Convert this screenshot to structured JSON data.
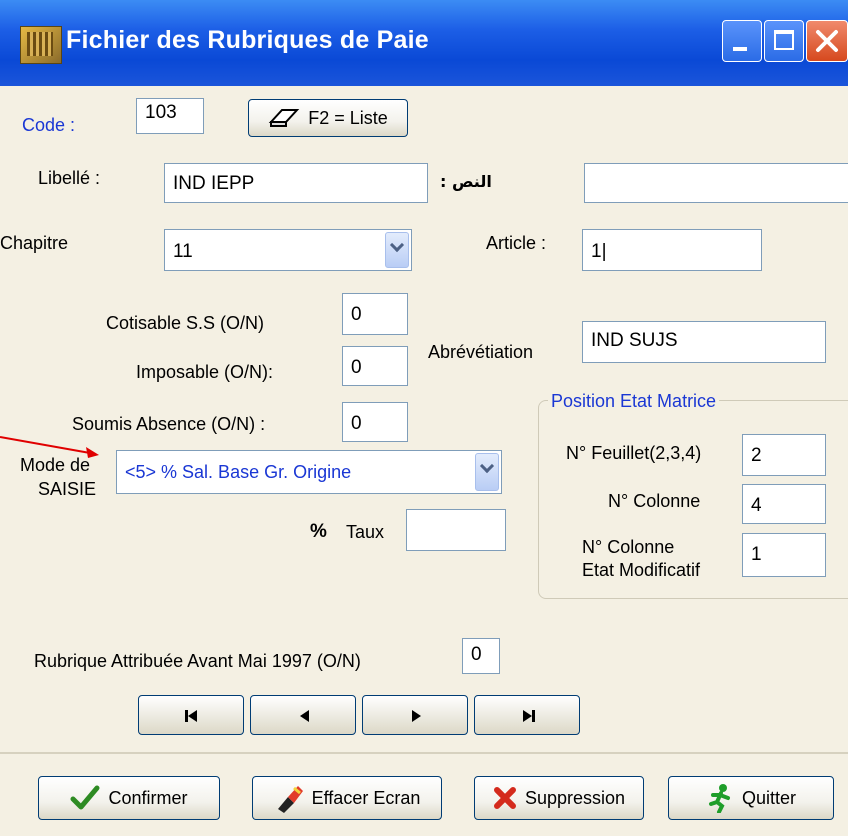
{
  "window": {
    "title": "Fichier des Rubriques de Paie"
  },
  "code": {
    "label": "Code :",
    "value": "103"
  },
  "liste_button": {
    "label": "F2 = Liste"
  },
  "libelle": {
    "label": "Libellé :",
    "value": "IND IEPP"
  },
  "arabic": {
    "label": ": النص",
    "value": ""
  },
  "chapitre": {
    "label": "Chapitre",
    "value": "11"
  },
  "article": {
    "label": "Article :",
    "value": "1|"
  },
  "cotisable": {
    "label": "Cotisable S.S (O/N)",
    "value": "0"
  },
  "imposable": {
    "label": "Imposable (O/N):",
    "value": "0"
  },
  "abreviation": {
    "label": "Abrévétiation",
    "value": "IND SUJS"
  },
  "soumis": {
    "label": "Soumis Absence (O/N) :",
    "value": "0"
  },
  "mode_saisie": {
    "label_line1": "Mode de",
    "label_line2": "SAISIE",
    "value": "<5>  % Sal. Base Gr. Origine"
  },
  "taux": {
    "symbol": "%",
    "label": "Taux",
    "value": ""
  },
  "position": {
    "title": "Position Etat Matrice",
    "feuillet": {
      "label": "N° Feuillet(2,3,4)",
      "value": "2"
    },
    "colonne": {
      "label": "N° Colonne",
      "value": "4"
    },
    "colonne_modif": {
      "label_line1": "N° Colonne",
      "label_line2": "Etat Modificatif",
      "value": "1"
    }
  },
  "rubrique_avant": {
    "label": "Rubrique Attribuée Avant  Mai 1997 (O/N)",
    "value": "0"
  },
  "nav": {
    "first": "first-record",
    "prev": "previous-record",
    "next": "next-record",
    "last": "last-record"
  },
  "actions": {
    "confirmer": "Confirmer",
    "effacer": "Effacer Ecran",
    "suppression": "Suppression",
    "quitter": "Quitter"
  },
  "colors": {
    "titlebar": "#0a49d6",
    "window_bg": "#f4f0e3",
    "label_blue": "#1a37d4",
    "annotation_arrow": "#e00000"
  }
}
